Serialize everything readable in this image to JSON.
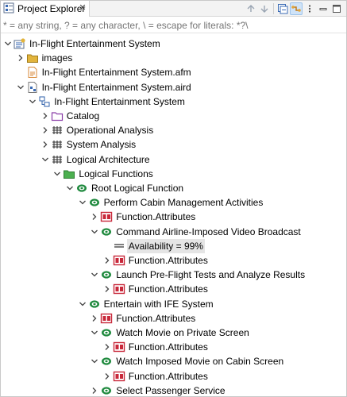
{
  "tab": {
    "title": "Project Explorer"
  },
  "filter": {
    "placeholder": "* = any string, ? = any character, \\ = escape for literals: *?\\"
  },
  "tree": [
    {
      "label": "In-Flight Entertainment System",
      "depth": 0,
      "toggle": "expanded",
      "icon": "project-icon"
    },
    {
      "label": "images",
      "depth": 1,
      "toggle": "collapsed",
      "icon": "folder-icon"
    },
    {
      "label": "In-Flight Entertainment System.afm",
      "depth": 1,
      "toggle": "none",
      "icon": "afm-file-icon"
    },
    {
      "label": "In-Flight Entertainment System.aird",
      "depth": 1,
      "toggle": "expanded",
      "icon": "aird-file-icon"
    },
    {
      "label": "In-Flight Entertainment System",
      "depth": 2,
      "toggle": "expanded",
      "icon": "model-icon"
    },
    {
      "label": "Catalog",
      "depth": 3,
      "toggle": "collapsed",
      "icon": "catalog-folder-icon"
    },
    {
      "label": "Operational Analysis",
      "depth": 3,
      "toggle": "collapsed",
      "icon": "package-icon"
    },
    {
      "label": "System Analysis",
      "depth": 3,
      "toggle": "collapsed",
      "icon": "package-icon"
    },
    {
      "label": "Logical Architecture",
      "depth": 3,
      "toggle": "expanded",
      "icon": "package-icon"
    },
    {
      "label": "Logical Functions",
      "depth": 4,
      "toggle": "expanded",
      "icon": "function-folder-icon"
    },
    {
      "label": "Root Logical Function",
      "depth": 5,
      "toggle": "expanded",
      "icon": "function-icon"
    },
    {
      "label": "Perform Cabin Management Activities",
      "depth": 6,
      "toggle": "expanded",
      "icon": "function-icon"
    },
    {
      "label": "Function.Attributes",
      "depth": 7,
      "toggle": "collapsed",
      "icon": "attributes-icon"
    },
    {
      "label": "Command Airline-Imposed Video Broadcast",
      "depth": 7,
      "toggle": "expanded",
      "icon": "function-icon"
    },
    {
      "label": "Availability = 99%",
      "depth": 8,
      "toggle": "none",
      "icon": "property-icon",
      "selected": true
    },
    {
      "label": "Function.Attributes",
      "depth": 8,
      "toggle": "collapsed",
      "icon": "attributes-icon"
    },
    {
      "label": "Launch Pre-Flight Tests and Analyze Results",
      "depth": 7,
      "toggle": "expanded",
      "icon": "function-icon"
    },
    {
      "label": "Function.Attributes",
      "depth": 8,
      "toggle": "collapsed",
      "icon": "attributes-icon"
    },
    {
      "label": "Entertain with IFE System",
      "depth": 6,
      "toggle": "expanded",
      "icon": "function-icon"
    },
    {
      "label": "Function.Attributes",
      "depth": 7,
      "toggle": "collapsed",
      "icon": "attributes-icon"
    },
    {
      "label": "Watch Movie on Private Screen",
      "depth": 7,
      "toggle": "expanded",
      "icon": "function-icon"
    },
    {
      "label": "Function.Attributes",
      "depth": 8,
      "toggle": "collapsed",
      "icon": "attributes-icon"
    },
    {
      "label": "Watch Imposed Movie on Cabin Screen",
      "depth": 7,
      "toggle": "expanded",
      "icon": "function-icon"
    },
    {
      "label": "Function.Attributes",
      "depth": 8,
      "toggle": "collapsed",
      "icon": "attributes-icon"
    },
    {
      "label": "Select Passenger Service",
      "depth": 7,
      "toggle": "collapsed",
      "icon": "function-icon"
    }
  ],
  "colors": {
    "function": "#1f8a3e",
    "folder": "#e2b43c",
    "catalog_folder": "#8a3ea8",
    "attributes": "#c8283a",
    "file": "#d88a3a",
    "model": "#2e5fa8"
  }
}
